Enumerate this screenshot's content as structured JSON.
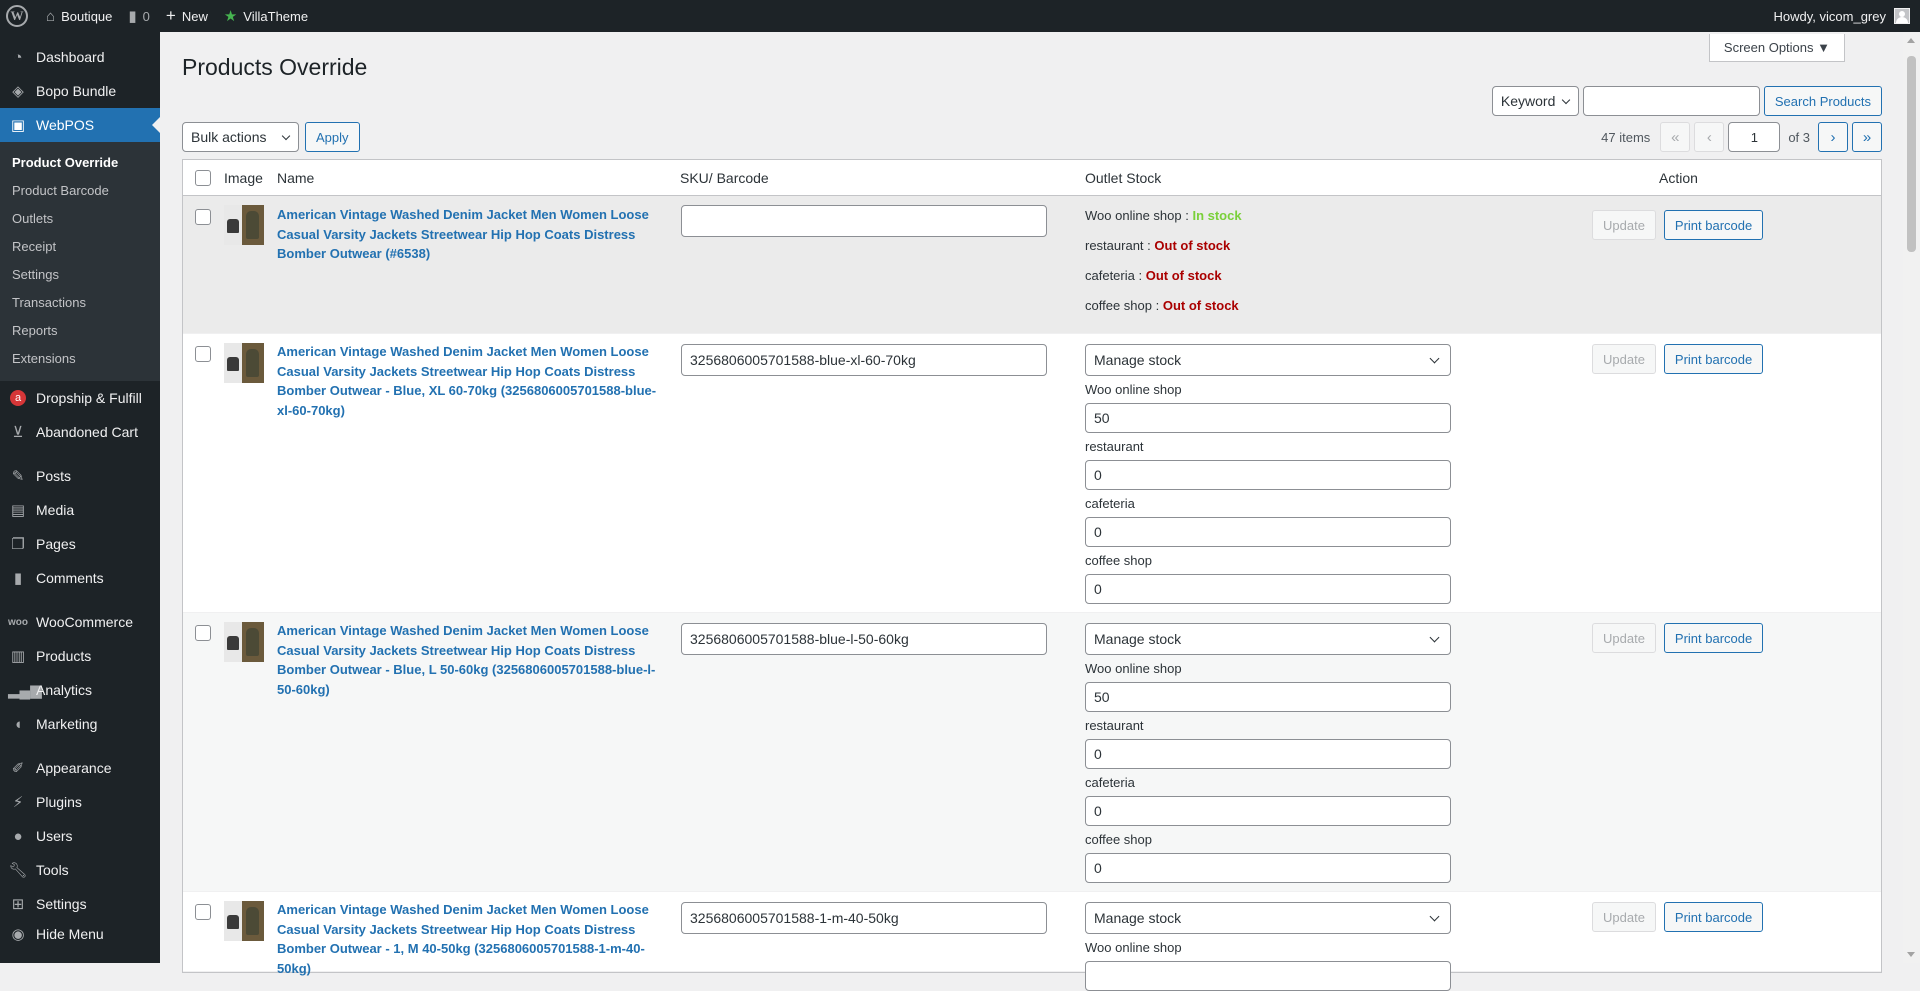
{
  "adminbar": {
    "site_name": "Boutique",
    "comments_count": "0",
    "new_label": "New",
    "villatheme_label": "VillaTheme",
    "howdy": "Howdy, vicom_grey"
  },
  "sidebar": {
    "top": [
      {
        "label": "Dashboard",
        "icon": "dashboard-icon"
      },
      {
        "label": "Bopo Bundle",
        "icon": "layers-icon"
      },
      {
        "label": "WebPOS",
        "icon": "pos-icon"
      }
    ],
    "submenu": [
      "Product Override",
      "Product Barcode",
      "Outlets",
      "Receipt",
      "Settings",
      "Transactions",
      "Reports",
      "Extensions"
    ],
    "group2": [
      {
        "label": "Dropship & Fulfill",
        "icon": "dropship-icon"
      },
      {
        "label": "Abandoned Cart",
        "icon": "cart-icon"
      }
    ],
    "group3": [
      {
        "label": "Posts",
        "icon": "pin-icon"
      },
      {
        "label": "Media",
        "icon": "media-icon"
      },
      {
        "label": "Pages",
        "icon": "pages-icon"
      },
      {
        "label": "Comments",
        "icon": "comment-icon"
      }
    ],
    "group4": [
      {
        "label": "WooCommerce",
        "icon": "woo-icon"
      },
      {
        "label": "Products",
        "icon": "archive-icon"
      },
      {
        "label": "Analytics",
        "icon": "chart-icon"
      },
      {
        "label": "Marketing",
        "icon": "megaphone-icon"
      }
    ],
    "group5": [
      {
        "label": "Appearance",
        "icon": "brush-icon"
      },
      {
        "label": "Plugins",
        "icon": "plugin-icon"
      },
      {
        "label": "Users",
        "icon": "user-icon"
      },
      {
        "label": "Tools",
        "icon": "wrench-icon"
      },
      {
        "label": "Settings",
        "icon": "sliders-icon"
      },
      {
        "label": "Hide Menu",
        "icon": "hide-icon"
      }
    ]
  },
  "header": {
    "title": "Products Override",
    "screen_options": "Screen Options ▼",
    "search_type": "Keyword",
    "search_value": "",
    "search_button": "Search Products"
  },
  "tablenav": {
    "bulk_actions": "Bulk actions",
    "apply": "Apply",
    "items_count": "47 items",
    "current_page": "1",
    "of_pages": "of 3",
    "first": "«",
    "prev": "‹",
    "next": "›",
    "last": "»"
  },
  "table": {
    "headers": {
      "image": "Image",
      "name": "Name",
      "sku": "SKU/ Barcode",
      "stock": "Outlet Stock",
      "action": "Action"
    },
    "update_label": "Update",
    "print_label": "Print barcode",
    "manage_stock": "Manage stock",
    "rows": [
      {
        "name": "American Vintage Washed Denim Jacket Men Women Loose Casual Varsity Jackets Streetwear Hip Hop Coats Distress Bomber Outwear (#6538)",
        "sku": "",
        "statuses": [
          {
            "outlet": "Woo online shop",
            "sep": " : ",
            "status": "In stock"
          },
          {
            "outlet": "restaurant",
            "sep": " : ",
            "status": "Out of stock"
          },
          {
            "outlet": "cafeteria",
            "sep": " : ",
            "status": "Out of stock"
          },
          {
            "outlet": "coffee shop",
            "sep": " : ",
            "status": "Out of stock"
          }
        ]
      },
      {
        "name": "American Vintage Washed Denim Jacket Men Women Loose Casual Varsity Jackets Streetwear Hip Hop Coats Distress Bomber Outwear - Blue, XL 60-70kg (3256806005701588-blue-xl-60-70kg)",
        "sku": "3256806005701588-blue-xl-60-70kg",
        "outlets": [
          {
            "label": "Woo online shop",
            "value": "50"
          },
          {
            "label": "restaurant",
            "value": "0"
          },
          {
            "label": "cafeteria",
            "value": "0"
          },
          {
            "label": "coffee shop",
            "value": "0"
          }
        ]
      },
      {
        "name": "American Vintage Washed Denim Jacket Men Women Loose Casual Varsity Jackets Streetwear Hip Hop Coats Distress Bomber Outwear - Blue, L 50-60kg (3256806005701588-blue-l-50-60kg)",
        "sku": "3256806005701588-blue-l-50-60kg",
        "outlets": [
          {
            "label": "Woo online shop",
            "value": "50"
          },
          {
            "label": "restaurant",
            "value": "0"
          },
          {
            "label": "cafeteria",
            "value": "0"
          },
          {
            "label": "coffee shop",
            "value": "0"
          }
        ]
      },
      {
        "name": "American Vintage Washed Denim Jacket Men Women Loose Casual Varsity Jackets Streetwear Hip Hop Coats Distress Bomber Outwear - 1, M 40-50kg (3256806005701588-1-m-40-50kg)",
        "sku": "3256806005701588-1-m-40-50kg",
        "outlets": [
          {
            "label": "Woo online shop",
            "value": ""
          }
        ]
      }
    ]
  },
  "colors": {
    "accent": "#2271b1",
    "in_stock": "#7ad03a",
    "out_of_stock": "#aa0000",
    "sidebar_bg": "#1d2327"
  }
}
